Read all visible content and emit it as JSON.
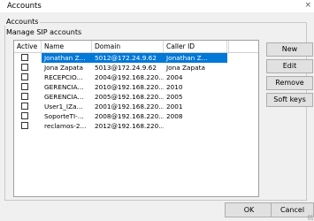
{
  "window": {
    "title": "Accounts",
    "close_glyph": "×"
  },
  "group": {
    "label": "Accounts",
    "description": "Manage SIP accounts"
  },
  "table": {
    "columns": [
      "Active",
      "Name",
      "Domain",
      "Caller ID"
    ],
    "rows": [
      {
        "active": false,
        "name": "Jonathan Z...",
        "domain": "5012@172.24.9.62",
        "caller_id": "Jonathan Z...",
        "selected": true
      },
      {
        "active": false,
        "name": "Jona Zapata",
        "domain": "5013@172.24.9.62",
        "caller_id": "Jona Zapata",
        "selected": false
      },
      {
        "active": false,
        "name": "RECEPCIO...",
        "domain": "2004@192.168.220...",
        "caller_id": "2004",
        "selected": false
      },
      {
        "active": false,
        "name": "GERENCIA...",
        "domain": "2010@192.168.220...",
        "caller_id": "2010",
        "selected": false
      },
      {
        "active": false,
        "name": "GERENCIA...",
        "domain": "2005@192.168.220...",
        "caller_id": "2005",
        "selected": false
      },
      {
        "active": false,
        "name": "User1_IZa...",
        "domain": "2001@192.168.220...",
        "caller_id": "2001",
        "selected": false
      },
      {
        "active": false,
        "name": "SoporteTI-...",
        "domain": "2008@192.168.220...",
        "caller_id": "2008",
        "selected": false
      },
      {
        "active": false,
        "name": "reclamos-2...",
        "domain": "2012@192.168.220...",
        "caller_id": "",
        "selected": false
      }
    ]
  },
  "side_buttons": {
    "new": "New",
    "edit": "Edit",
    "remove": "Remove",
    "soft_keys": "Soft keys"
  },
  "footer": {
    "ok": "OK",
    "cancel": "Cancel"
  },
  "colors": {
    "selection": "#0078d7",
    "background": "#f0f0f0"
  }
}
